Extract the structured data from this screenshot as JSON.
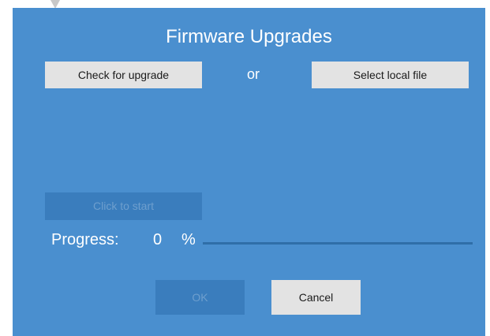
{
  "dialog": {
    "title": "Firmware Upgrades",
    "check_upgrade_label": "Check for upgrade",
    "or_label": "or",
    "select_file_label": "Select local file",
    "start_label": "Click to start",
    "progress_label": "Progress:",
    "progress_value": "0",
    "progress_unit": "%",
    "progress_fraction": 0,
    "ok_label": "OK",
    "cancel_label": "Cancel"
  },
  "colors": {
    "background": "#4a8fcf",
    "button_light": "#e3e3e3",
    "button_disabled": "#3a7dbd",
    "progress_track": "#2f6ea8"
  }
}
